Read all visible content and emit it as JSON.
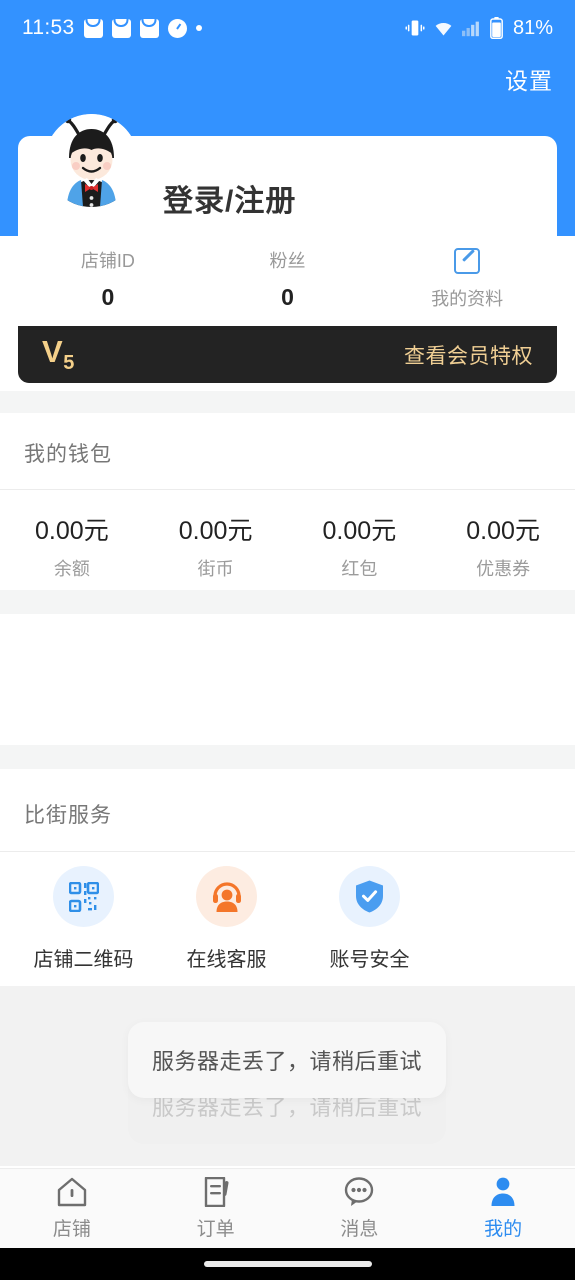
{
  "status_bar": {
    "time": "11:53",
    "battery": "81%",
    "icons": [
      "shopping-bag-icon",
      "shopping-bag-icon",
      "shopping-bag-icon",
      "clock-icon",
      "dot-icon"
    ],
    "right_icons": [
      "vibrate-icon",
      "wifi-icon",
      "signal-icon",
      "battery-icon"
    ]
  },
  "header": {
    "settings_label": "设置",
    "background_color": "#3392ff"
  },
  "profile": {
    "avatar_icon": "ant-mascot-avatar",
    "login_label": "登录/注册",
    "stats": [
      {
        "label": "店铺ID",
        "value": "0"
      },
      {
        "label": "粉丝",
        "value": "0"
      }
    ],
    "profile_action": {
      "icon": "edit-square-icon",
      "label": "我的资料"
    }
  },
  "vip": {
    "level_prefix": "V",
    "level_number": "5",
    "link_label": "查看会员特权",
    "background_color": "#232323",
    "text_color": "#f0cf94"
  },
  "wallet": {
    "title": "我的钱包",
    "items": [
      {
        "amount": "0.00元",
        "label": "余额"
      },
      {
        "amount": "0.00元",
        "label": "街币"
      },
      {
        "amount": "0.00元",
        "label": "红包"
      },
      {
        "amount": "0.00元",
        "label": "优惠券"
      }
    ]
  },
  "services": {
    "title": "比街服务",
    "items": [
      {
        "label": "店铺二维码",
        "icon": "qr-code-icon",
        "color": "#2f8fe8"
      },
      {
        "label": "在线客服",
        "icon": "headset-support-icon",
        "color": "#f4762a"
      },
      {
        "label": "账号安全",
        "icon": "shield-check-icon",
        "color": "#4a9df0"
      }
    ]
  },
  "toasts": [
    {
      "message": "服务器走丢了，请稍后重试"
    },
    {
      "message": "服务器走丢了，请稍后重试"
    }
  ],
  "bottom_nav": {
    "active_color": "#2d8cf0",
    "items": [
      {
        "label": "店铺",
        "icon": "home-icon",
        "active": false
      },
      {
        "label": "订单",
        "icon": "order-document-icon",
        "active": false
      },
      {
        "label": "消息",
        "icon": "chat-bubble-icon",
        "active": false
      },
      {
        "label": "我的",
        "icon": "person-icon",
        "active": true
      }
    ]
  }
}
